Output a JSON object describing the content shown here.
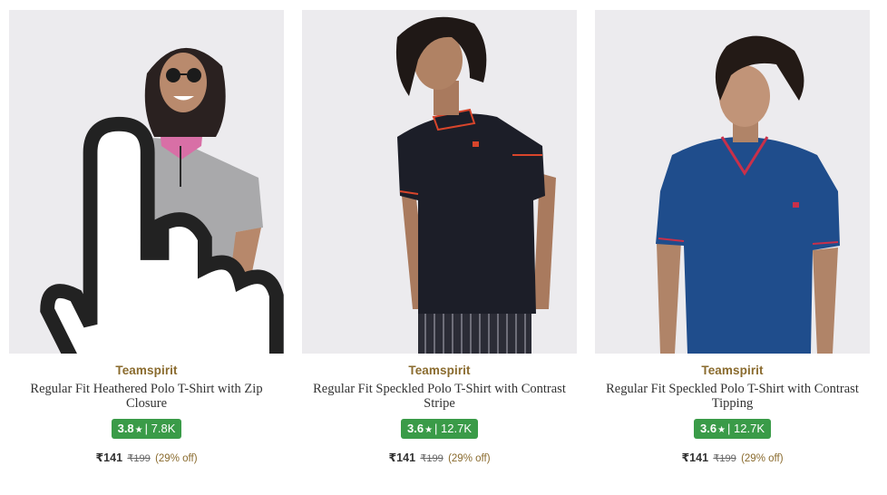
{
  "products": [
    {
      "brand": "Teamspirit",
      "title": "Regular Fit Heathered Polo T-Shirt with Zip Closure",
      "rating": "3.8",
      "rating_count": "7.8K",
      "price": "₹141",
      "mrp": "₹199",
      "discount": "(29% off)",
      "shirt_color": "#a9a9ab"
    },
    {
      "brand": "Teamspirit",
      "title": "Regular Fit Speckled Polo T-Shirt with Contrast Stripe",
      "rating": "3.6",
      "rating_count": "12.7K",
      "price": "₹141",
      "mrp": "₹199",
      "discount": "(29% off)",
      "shirt_color": "#1c1e28"
    },
    {
      "brand": "Teamspirit",
      "title": "Regular Fit Speckled Polo T-Shirt with Contrast Tipping",
      "rating": "3.6",
      "rating_count": "12.7K",
      "price": "₹141",
      "mrp": "₹199",
      "discount": "(29% off)",
      "shirt_color": "#1f4d8c"
    }
  ],
  "colors": {
    "rating_badge": "#3a9b48",
    "brand": "#8a6b2e",
    "image_bg": "#ecebee"
  },
  "icons": {
    "rating_star": "★",
    "cursor": "hand-pointer-icon"
  }
}
